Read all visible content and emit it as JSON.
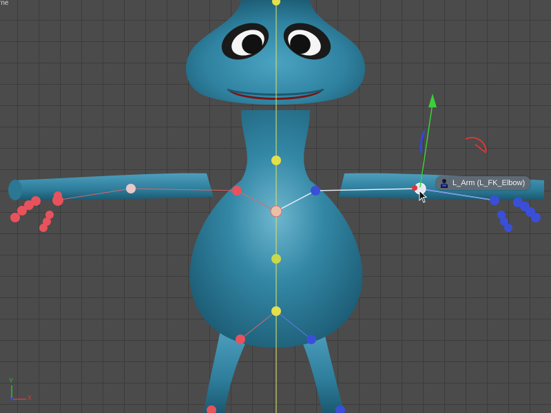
{
  "viewport": {
    "corner_label": "rne",
    "axis_y_label": "Y",
    "axis_x_label": "X"
  },
  "tooltip": {
    "text": "L_Arm (L_FK_Elbow)",
    "icon": "joint-icon"
  },
  "colors": {
    "body": "#2f7f9c",
    "joint_center": "#e4e04a",
    "joint_right": "#e8525c",
    "joint_left": "#3a4fd8",
    "gizmo_y": "#3ad13a",
    "gizmo_x": "#e03535",
    "gizmo_z": "#2f49e0"
  }
}
